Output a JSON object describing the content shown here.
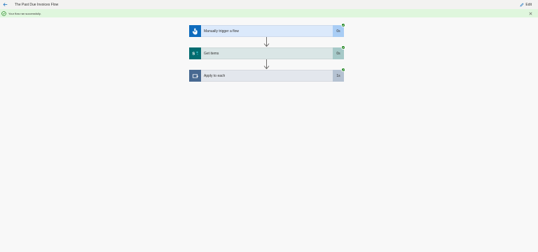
{
  "header": {
    "flow_title": "The Past Due Invoices Flow",
    "edit_label": "Edit"
  },
  "banner": {
    "message": "Your flow ran successfully."
  },
  "steps": [
    {
      "title": "Manually trigger a flow",
      "duration": "0s",
      "icon": "hand-pointer-icon",
      "accent": "#0f6cbd",
      "body_bg": "#dbe9fb",
      "dur_bg": "#a9cdf5"
    },
    {
      "title": "Get items",
      "duration": "0s",
      "icon": "sharepoint-icon",
      "accent": "#036c70",
      "body_bg": "#dae6e6",
      "dur_bg": "#a6c9c8"
    },
    {
      "title": "Apply to each",
      "duration": "1s",
      "icon": "loop-icon",
      "accent": "#486991",
      "body_bg": "#e3e7ed",
      "dur_bg": "#b5c2d2"
    }
  ]
}
